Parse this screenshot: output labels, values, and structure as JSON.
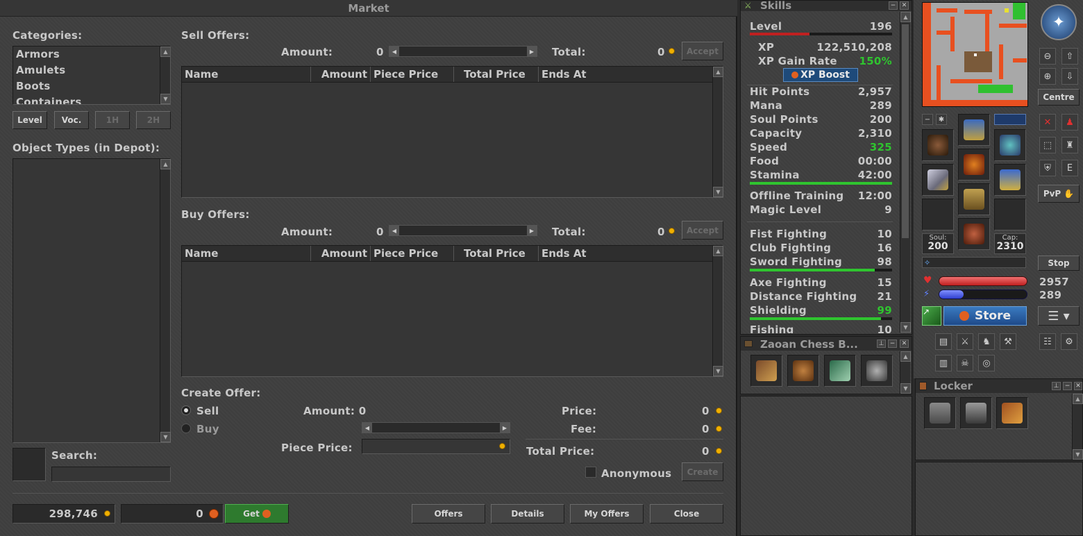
{
  "market": {
    "title": "Market",
    "categories_label": "Categories:",
    "categories": [
      "Armors",
      "Amulets",
      "Boots",
      "Containers"
    ],
    "filter_buttons": [
      "Level",
      "Voc.",
      "1H",
      "2H"
    ],
    "object_types_label": "Object Types (in Depot):",
    "search_label": "Search:",
    "sell_offers_label": "Sell Offers:",
    "buy_offers_label": "Buy Offers:",
    "amount_label": "Amount:",
    "total_label": "Total:",
    "sell_amount": "0",
    "sell_total": "0",
    "buy_amount": "0",
    "buy_total": "0",
    "accept_label": "Accept",
    "columns": [
      "Name",
      "Amount",
      "Piece Price",
      "Total Price",
      "Ends At"
    ],
    "create_offer_label": "Create Offer:",
    "sell_option": "Sell",
    "buy_option": "Buy",
    "create_amount_label": "Amount: 0",
    "piece_price_label": "Piece Price:",
    "price_label": "Price:",
    "price_value": "0",
    "fee_label": "Fee:",
    "fee_value": "0",
    "total_price_label": "Total Price:",
    "total_price_value": "0",
    "anonymous_label": "Anonymous",
    "create_label": "Create",
    "gold_balance": "298,746",
    "coins_balance": "0",
    "get_label": "Get",
    "offers_label": "Offers",
    "details_label": "Details",
    "my_offers_label": "My Offers",
    "close_label": "Close"
  },
  "skills": {
    "title": "Skills",
    "level_label": "Level",
    "level_value": "196",
    "level_progress": 0.42,
    "xp_label": "XP",
    "xp_value": "122,510,208",
    "xp_gain_label": "XP Gain Rate",
    "xp_gain_value": "150%",
    "xp_boost_label": "XP Boost",
    "rows1": [
      {
        "label": "Hit Points",
        "value": "2,957"
      },
      {
        "label": "Mana",
        "value": "289"
      },
      {
        "label": "Soul Points",
        "value": "200"
      },
      {
        "label": "Capacity",
        "value": "2,310"
      },
      {
        "label": "Speed",
        "value": "325",
        "green": true
      },
      {
        "label": "Food",
        "value": "00:00"
      },
      {
        "label": "Stamina",
        "value": "42:00"
      }
    ],
    "offline_label": "Offline Training",
    "offline_value": "12:00",
    "magic_label": "Magic Level",
    "magic_value": "9",
    "fighting": [
      {
        "label": "Fist Fighting",
        "value": "10"
      },
      {
        "label": "Club Fighting",
        "value": "16"
      },
      {
        "label": "Sword Fighting",
        "value": "98"
      },
      {
        "label": "Axe Fighting",
        "value": "15"
      },
      {
        "label": "Distance Fighting",
        "value": "21"
      },
      {
        "label": "Shielding",
        "value": "99",
        "green": true
      },
      {
        "label": "Fishing",
        "value": "10"
      }
    ]
  },
  "chess": {
    "title": "Zaoan Chess B..."
  },
  "locker": {
    "title": "Locker"
  },
  "equipment": {
    "soul_label": "Soul:",
    "soul_value": "200",
    "cap_label": "Cap:",
    "cap_value": "2310",
    "centre_label": "Centre",
    "stop_label": "Stop",
    "pvp_label": "PvP",
    "e_label": "E",
    "hp_value": "2957",
    "mana_value": "289",
    "store_label": "Store"
  },
  "colors": {
    "green": "#2fc42f",
    "hp": "#d83030",
    "mana": "#3050e0",
    "accent_blue": "#1e5aa0"
  }
}
